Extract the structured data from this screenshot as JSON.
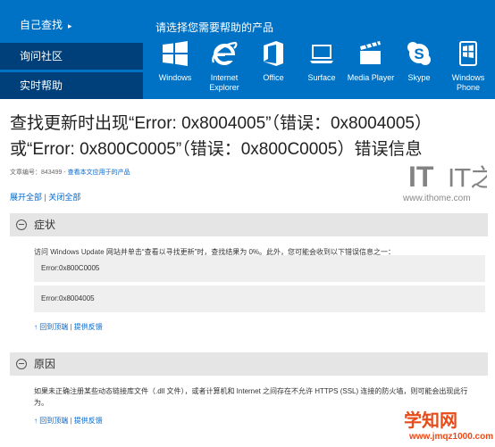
{
  "sidebar": {
    "items": [
      {
        "label": "自己查找",
        "arrow": "▸"
      },
      {
        "label": "询问社区"
      },
      {
        "label": "实时帮助"
      }
    ]
  },
  "products": {
    "heading": "请选择您需要帮助的产品",
    "items": [
      {
        "label": "Windows",
        "icon": "windows-icon"
      },
      {
        "label": "Internet Explorer",
        "icon": "internet-explorer-icon"
      },
      {
        "label": "Office",
        "icon": "office-icon"
      },
      {
        "label": "Surface",
        "icon": "surface-icon"
      },
      {
        "label": "Media Player",
        "icon": "media-player-icon"
      },
      {
        "label": "Skype",
        "icon": "skype-icon"
      },
      {
        "label": "Windows Phone",
        "icon": "windows-phone-icon"
      }
    ]
  },
  "article": {
    "title": "查找更新时出现“Error: 0x8004005”（错误：0x8004005）或“Error: 0x800C0005”（错误：0x800C0005）错误信息",
    "id_label": "文章编号：843499 -",
    "applies_link": "查看本文应用于的产品",
    "expand_all": "展开全部",
    "collapse_all": "关闭全部"
  },
  "watermark": {
    "it": "IT之家",
    "url": "www.ithome.com",
    "site2": "学知网",
    "site2_url": "www.jmqz1000.com"
  },
  "sections": [
    {
      "title": "症状",
      "text": "访问 Windows Update 网站并单击“查看以寻找更新”时，查找结果为 0%。此外，您可能会收到以下错误信息之一：",
      "errors": [
        "Error:0x800C0005",
        "Error:0x8004005"
      ],
      "back_top": "回到顶端",
      "feedback": "提供反馈"
    },
    {
      "title": "原因",
      "text": "如果未正确注册某些动态链接库文件（.dll 文件），或者计算机和 Internet 之间存在不允许 HTTPS (SSL) 连接的防火墙，则可能会出现此行为。",
      "back_top": "回到顶端",
      "feedback": "提供反馈"
    }
  ],
  "colors": {
    "brand_blue": "#0072c6",
    "sidebar_dark": "#00407a",
    "link": "#0066cc"
  }
}
